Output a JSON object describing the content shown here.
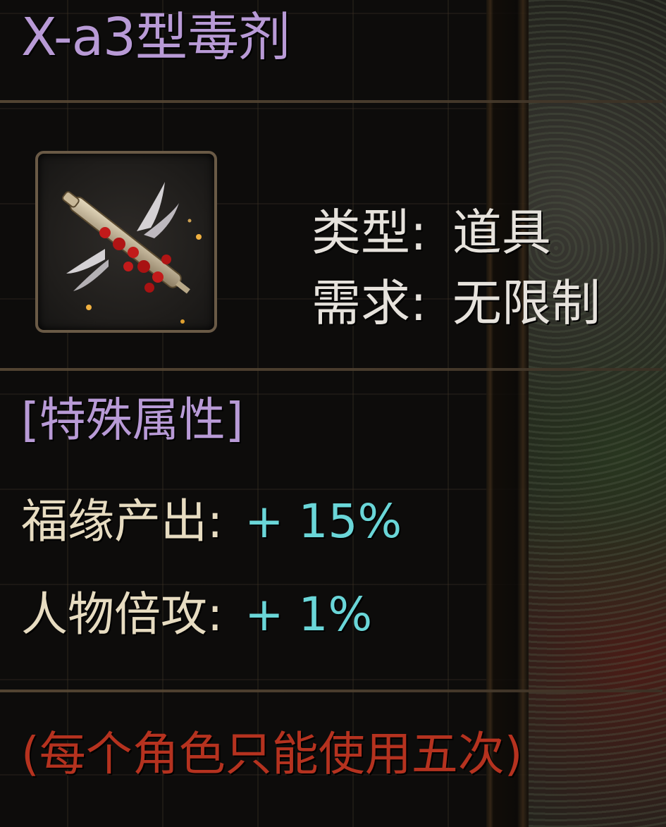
{
  "item": {
    "name": "X-a3型毒剂",
    "icon": "syringe-icon",
    "type_label": "类型:",
    "type_value": "道具",
    "requirement_label": "需求:",
    "requirement_value": "无限制"
  },
  "special": {
    "heading": "[特殊属性]",
    "attributes": [
      {
        "name": "福缘产出:",
        "value": "+ 15%"
      },
      {
        "name": "人物倍攻:",
        "value": "+ 1%"
      }
    ]
  },
  "usage_note": "(每个角色只能使用五次)",
  "colors": {
    "title": "#b89ad6",
    "attribute_name": "#e7dcc1",
    "attribute_value": "#6ad6d8",
    "warning": "#b5321f",
    "info_text": "#e6e2dc"
  }
}
